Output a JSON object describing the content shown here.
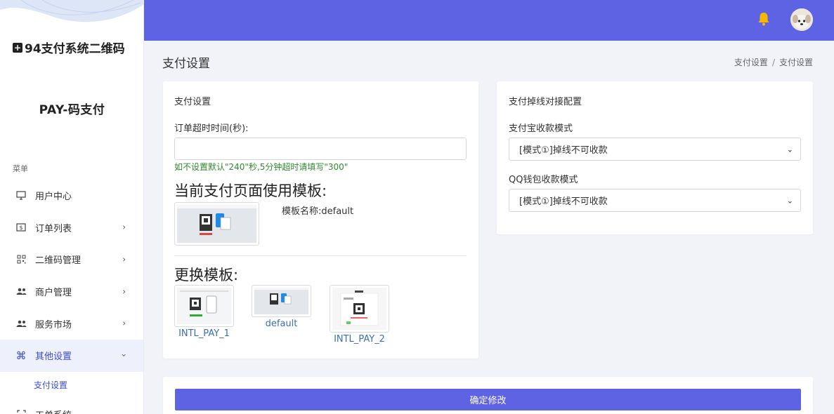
{
  "brand": {
    "title": "94支付系统二维码",
    "subtitle": "PAY-码支付"
  },
  "sidebar": {
    "caption": "菜单",
    "items": [
      {
        "label": "用户中心",
        "icon": "monitor-icon",
        "expandable": false
      },
      {
        "label": "订单列表",
        "icon": "dollar-icon",
        "expandable": true
      },
      {
        "label": "二维码管理",
        "icon": "qrcode-icon",
        "expandable": true
      },
      {
        "label": "商户管理",
        "icon": "users-icon",
        "expandable": true
      },
      {
        "label": "服务市场",
        "icon": "users-icon",
        "expandable": true
      },
      {
        "label": "其他设置",
        "icon": "command-icon",
        "expandable": true,
        "active": true
      },
      {
        "label": "工单系统",
        "icon": "ticket-icon",
        "expandable": false
      }
    ],
    "active_sub": "支付设置"
  },
  "header": {
    "accent": "#5e63e4"
  },
  "page": {
    "title": "支付设置",
    "breadcrumb": [
      "支付设置",
      "支付设置"
    ],
    "breadcrumb_sep": "/"
  },
  "settings_card": {
    "title": "支付设置",
    "timeout_label": "订单超时时间(秒):",
    "timeout_value": "",
    "timeout_help": "如不设置默认\"240\"秒,5分钟超时请填写\"300\"",
    "current_template_heading": "当前支付页面使用模板:",
    "template_name_label": "模板名称:",
    "template_name_value": "default",
    "change_template_heading": "更换模板:",
    "templates": [
      "INTL_PAY_1",
      "default",
      "INTL_PAY_2"
    ]
  },
  "offline_card": {
    "title": "支付掉线对接配置",
    "alipay_label": "支付宝收款模式",
    "alipay_value": "[模式①]掉线不可收款",
    "qq_label": "QQ钱包收款模式",
    "qq_value": "[模式①]掉线不可收款"
  },
  "submit": {
    "label": "确定修改"
  }
}
